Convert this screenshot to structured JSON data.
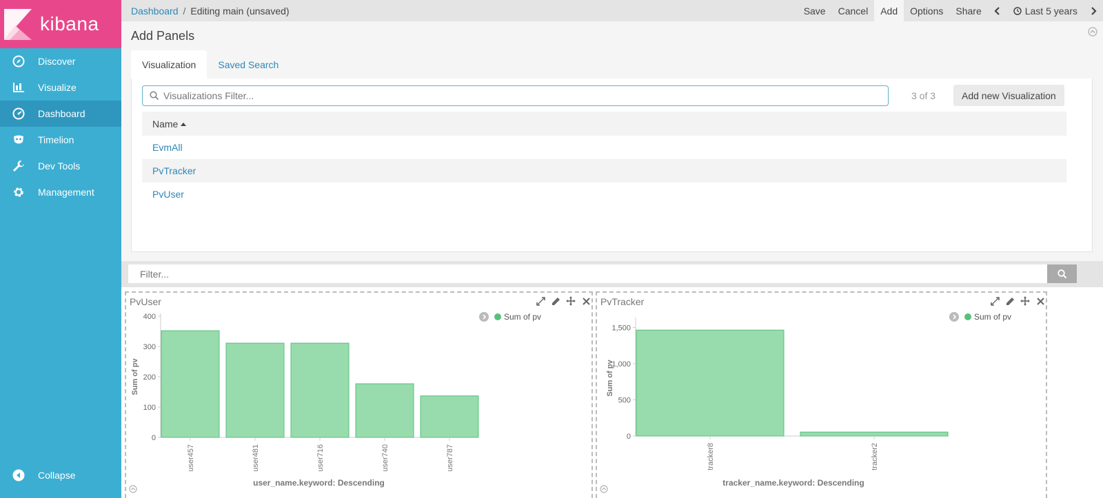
{
  "brand": {
    "name": "kibana",
    "logo_colors": [
      "#e8488b",
      "#f7a9c6"
    ]
  },
  "sidebar": {
    "items": [
      {
        "label": "Discover",
        "icon": "compass-icon"
      },
      {
        "label": "Visualize",
        "icon": "bar-chart-icon"
      },
      {
        "label": "Dashboard",
        "icon": "dashboard-gauge-icon",
        "active": true
      },
      {
        "label": "Timelion",
        "icon": "timelion-mask-icon"
      },
      {
        "label": "Dev Tools",
        "icon": "wrench-icon"
      },
      {
        "label": "Management",
        "icon": "gear-icon"
      }
    ],
    "collapse_label": "Collapse"
  },
  "breadcrumb": {
    "parent": "Dashboard",
    "separator": "/",
    "current": "Editing main (unsaved)"
  },
  "top_menu": {
    "save": "Save",
    "cancel": "Cancel",
    "add": "Add",
    "options": "Options",
    "share": "Share",
    "time_range": "Last 5 years"
  },
  "add_panels": {
    "title": "Add Panels",
    "tabs": [
      "Visualization",
      "Saved Search"
    ],
    "filter_placeholder": "Visualizations Filter...",
    "count": "3 of 3",
    "add_new_label": "Add new Visualization",
    "column_header": "Name",
    "items": [
      "EvmAll",
      "PvTracker",
      "PvUser"
    ]
  },
  "query_filter": {
    "placeholder": "Filter..."
  },
  "colors": {
    "bar_fill": "#98dbad",
    "bar_stroke": "#57c17b",
    "legend_dot": "#57c17b",
    "accent": "#2d87b8",
    "sidebar": "#3caed2"
  },
  "panels": [
    {
      "title": "PvUser",
      "legend": "Sum of pv",
      "chart_data": {
        "type": "bar",
        "categories": [
          "user457",
          "user481",
          "user716",
          "user740",
          "user787"
        ],
        "series": [
          {
            "name": "Sum of pv",
            "values": [
              352,
              311,
              311,
              177,
              137
            ]
          }
        ],
        "xlabel": "user_name.keyword: Descending",
        "ylabel": "Sum of pv",
        "ylim": [
          0,
          400
        ],
        "yticks": [
          0,
          100,
          200,
          300,
          400
        ],
        "ytick_labels": [
          "0",
          "100",
          "200",
          "300",
          "400"
        ]
      }
    },
    {
      "title": "PvTracker",
      "legend": "Sum of pv",
      "chart_data": {
        "type": "bar",
        "categories": [
          "tracker8",
          "tracker2"
        ],
        "series": [
          {
            "name": "Sum of pv",
            "values": [
              1465,
              55
            ]
          }
        ],
        "xlabel": "tracker_name.keyword: Descending",
        "ylabel": "Sum of pv",
        "ylim": [
          0,
          1600
        ],
        "yticks": [
          0,
          500,
          1000,
          1500
        ],
        "ytick_labels": [
          "0",
          "500",
          "1,000",
          "1,500"
        ]
      }
    }
  ]
}
